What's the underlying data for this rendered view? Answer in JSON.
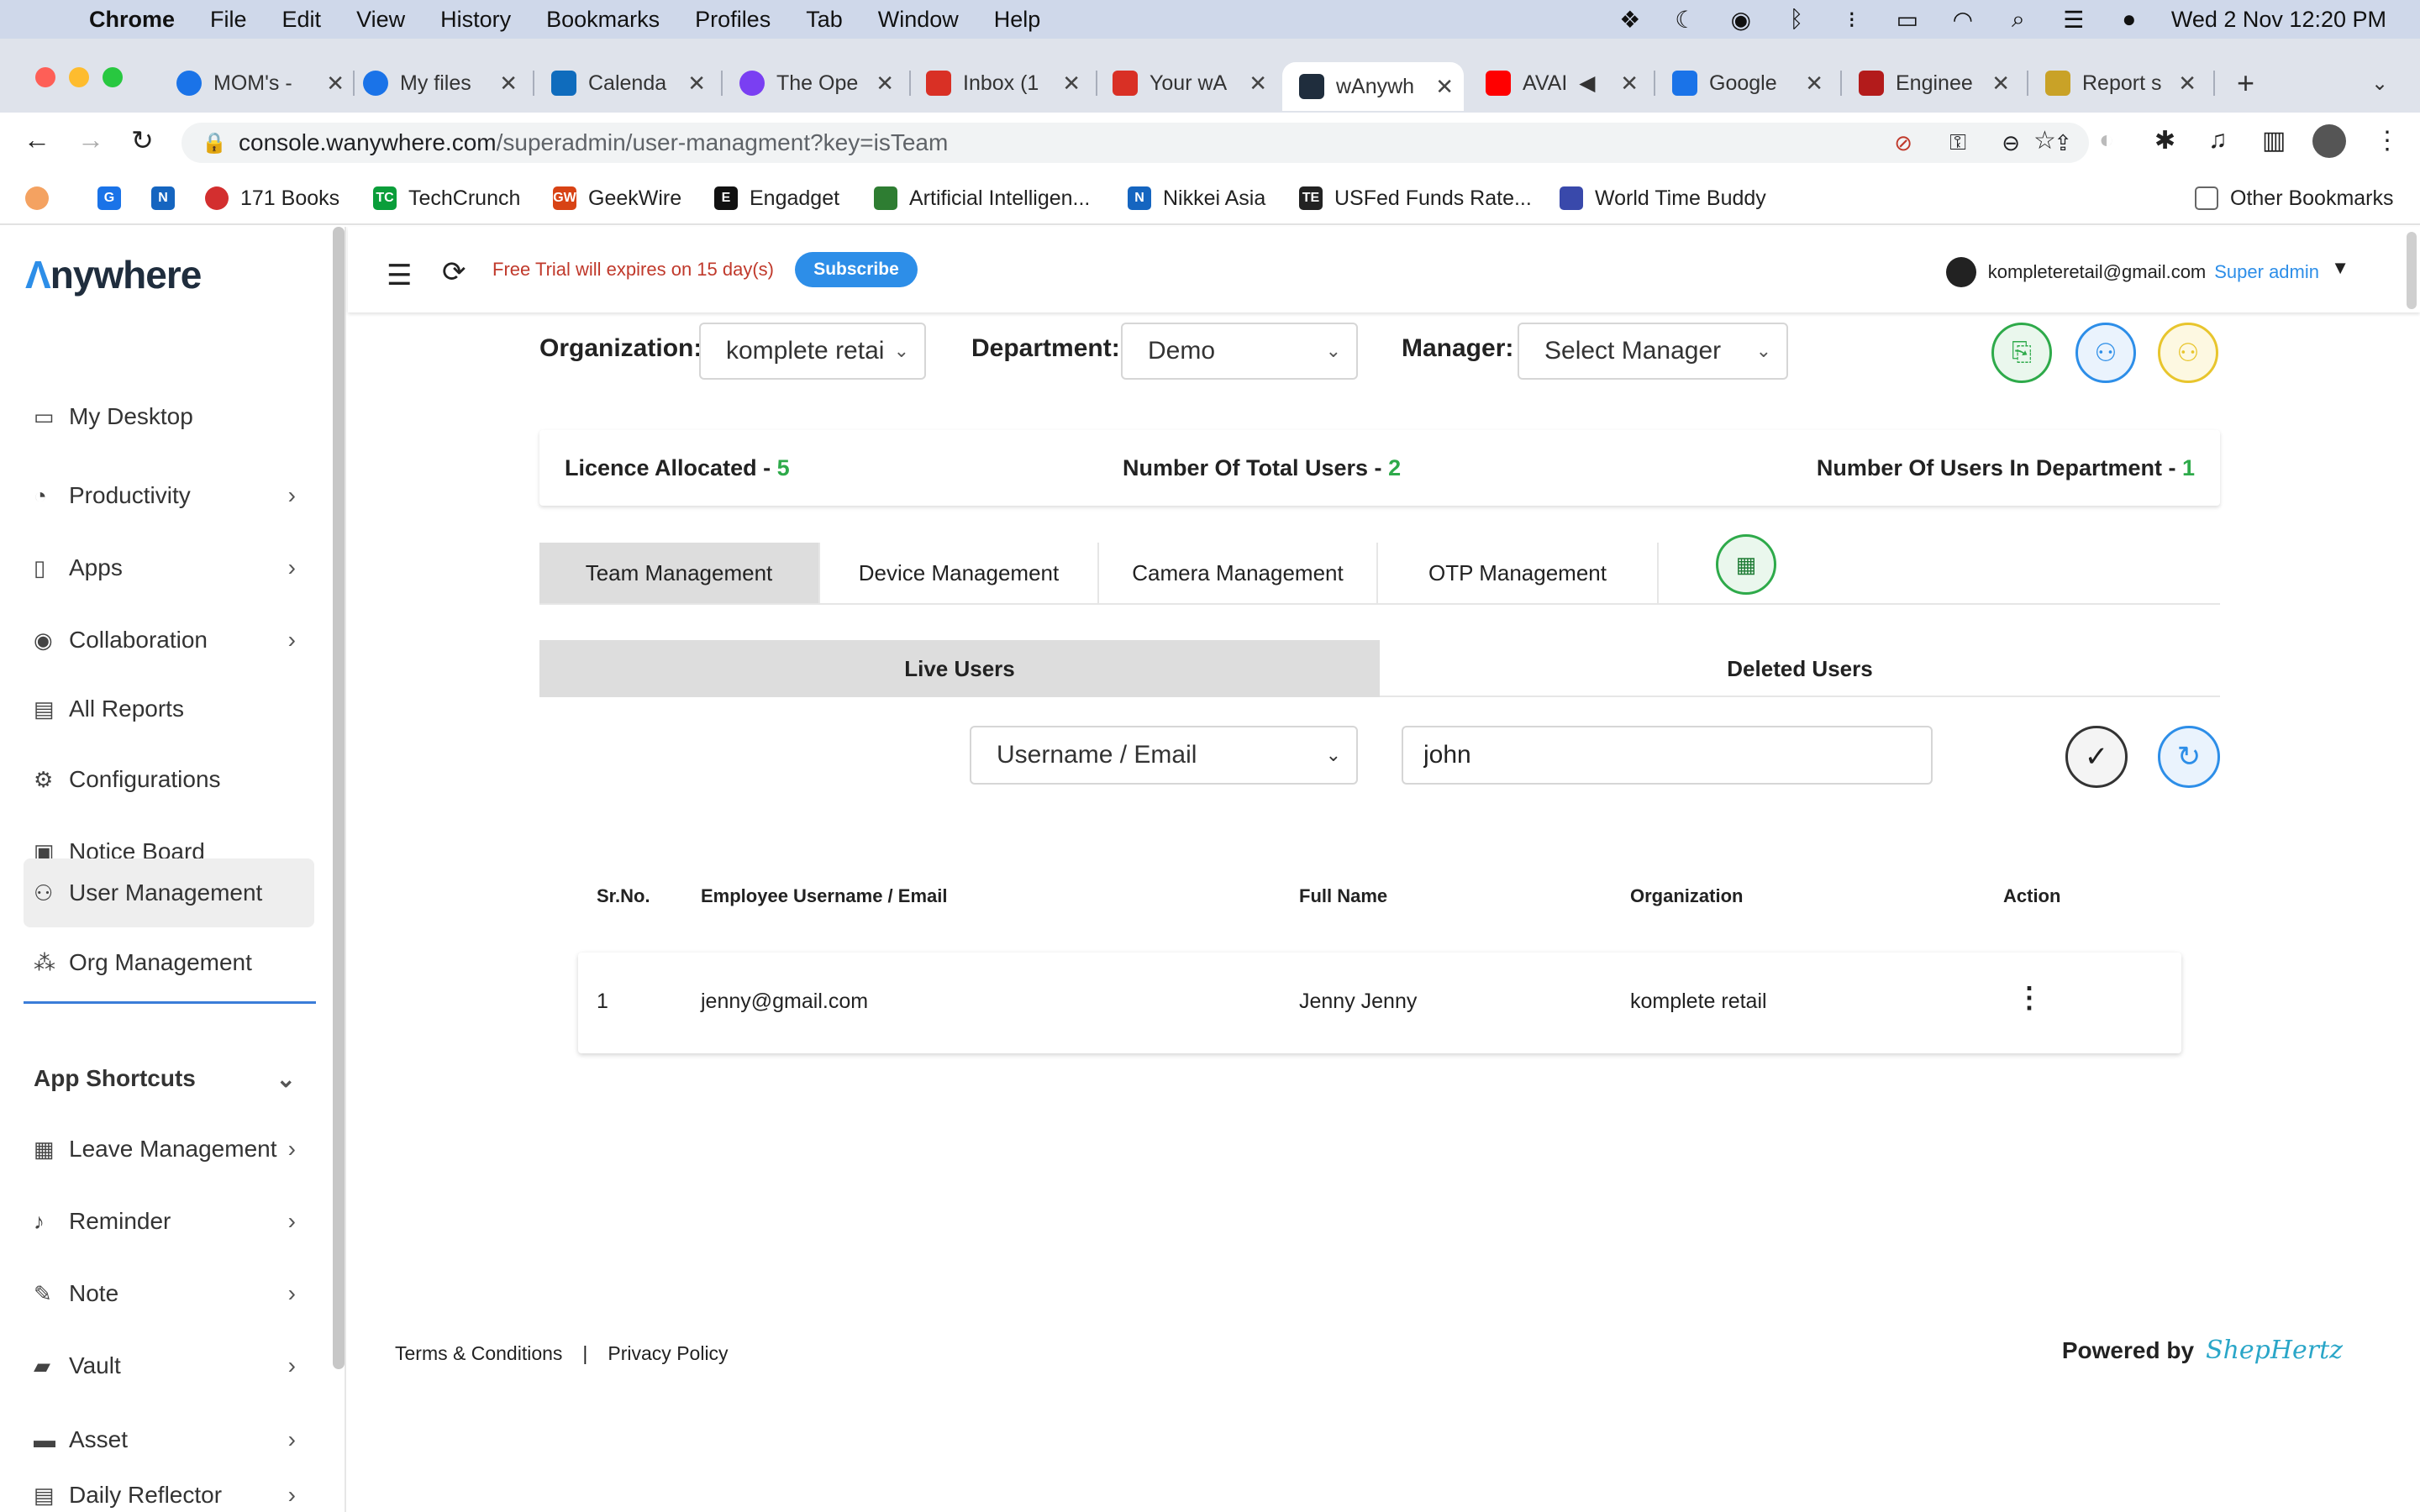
{
  "menubar": {
    "app": "Chrome",
    "items": [
      "File",
      "Edit",
      "View",
      "History",
      "Bookmarks",
      "Profiles",
      "Tab",
      "Window",
      "Help"
    ],
    "datetime": "Wed 2 Nov  12:20 PM"
  },
  "tabs": [
    {
      "label": "MOM's -",
      "color": "#1a73e8"
    },
    {
      "label": "My files",
      "color": "#1a73e8"
    },
    {
      "label": "Calenda",
      "color": "#0f6cbd"
    },
    {
      "label": "The Ope",
      "color": "#7a3ff2"
    },
    {
      "label": "Inbox (1",
      "color": "#d93025"
    },
    {
      "label": "Your wA",
      "color": "#d93025"
    },
    {
      "label": "wAnywh",
      "color": "#1f2d3d"
    },
    {
      "label": "AVAI",
      "color": "#ff0000"
    },
    {
      "label": "Google",
      "color": "#1a73e8"
    },
    {
      "label": "Enginee",
      "color": "#b31b1b"
    },
    {
      "label": "Report s",
      "color": "#c9a227"
    }
  ],
  "address": {
    "domain": "console.wanywhere.com",
    "path": "/superadmin/user-managment?key=isTeam"
  },
  "bookmarks": [
    {
      "label": "",
      "icon": "G",
      "color": "#1a73e8"
    },
    {
      "label": "",
      "icon": "N",
      "color": "#1565c0"
    },
    {
      "label": "171 Books",
      "icon": "",
      "color": "#d32f2f"
    },
    {
      "label": "TechCrunch",
      "icon": "TC",
      "color": "#0a9e3a"
    },
    {
      "label": "GeekWire",
      "icon": "GW",
      "color": "#d84315"
    },
    {
      "label": "Engadget",
      "icon": "E",
      "color": "#111111"
    },
    {
      "label": "Artificial Intelligen...",
      "icon": "",
      "color": "#2e7d32"
    },
    {
      "label": "Nikkei Asia",
      "icon": "N",
      "color": "#1565c0"
    },
    {
      "label": "USFed Funds Rate...",
      "icon": "TE",
      "color": "#222222"
    },
    {
      "label": "World Time Buddy",
      "icon": "",
      "color": "#3949ab"
    }
  ],
  "other_bookmarks": "Other Bookmarks",
  "brand": {
    "logo_text": "nywhere"
  },
  "sidebar": {
    "items": [
      {
        "label": "My Desktop",
        "icon": "desktop-icon"
      },
      {
        "label": "Productivity",
        "icon": "pie-chart-icon"
      },
      {
        "label": "Apps",
        "icon": "phone-icon"
      },
      {
        "label": "Collaboration",
        "icon": "collaboration-icon"
      },
      {
        "label": "All Reports",
        "icon": "clipboard-icon"
      },
      {
        "label": "Configurations",
        "icon": "gear-icon"
      },
      {
        "label": "Notice Board",
        "icon": "notice-board-icon"
      },
      {
        "label": "User Management",
        "icon": "users-icon"
      },
      {
        "label": "Org Management",
        "icon": "org-icon"
      }
    ],
    "section_title": "App Shortcuts",
    "shortcuts": [
      {
        "label": "Leave Management",
        "icon": "calendar-icon"
      },
      {
        "label": "Reminder",
        "icon": "bell-icon"
      },
      {
        "label": "Note",
        "icon": "note-icon"
      },
      {
        "label": "Vault",
        "icon": "vault-icon"
      },
      {
        "label": "Asset",
        "icon": "asset-icon"
      },
      {
        "label": "Daily Reflector",
        "icon": "reflector-icon"
      }
    ]
  },
  "header": {
    "trial_text": "Free Trial will expires on 15 day(s)",
    "subscribe_label": "Subscribe",
    "user_email": "kompleteretail@gmail.com",
    "user_role": "Super admin"
  },
  "filters": {
    "org_label": "Organization:",
    "org_value": "komplete retai",
    "dept_label": "Department:",
    "dept_value": "Demo",
    "manager_label": "Manager:",
    "manager_value": "Select Manager"
  },
  "stats": {
    "licence_label": "Licence Allocated - ",
    "licence_value": "5",
    "total_label": "Number Of Total Users - ",
    "total_value": "2",
    "dept_label": "Number Of Users In Department - ",
    "dept_value": "1",
    "accent": "#2eaa4a"
  },
  "tabs_main": [
    "Team Management",
    "Device Management",
    "Camera Management",
    "OTP Management"
  ],
  "subtabs": [
    "Live Users",
    "Deleted Users"
  ],
  "search": {
    "field": "Username / Email",
    "value": "john"
  },
  "table": {
    "headers": [
      "Sr.No.",
      "Employee Username / Email",
      "Full Name",
      "Organization",
      "Action"
    ],
    "rows": [
      {
        "sr": "1",
        "email": "jenny@gmail.com",
        "name": "Jenny Jenny",
        "org": "komplete retail"
      }
    ]
  },
  "footer": {
    "terms": "Terms & Conditions",
    "sep": "|",
    "privacy": "Privacy Policy",
    "powered": "Powered by",
    "powered_brand": "ShepHertz"
  }
}
